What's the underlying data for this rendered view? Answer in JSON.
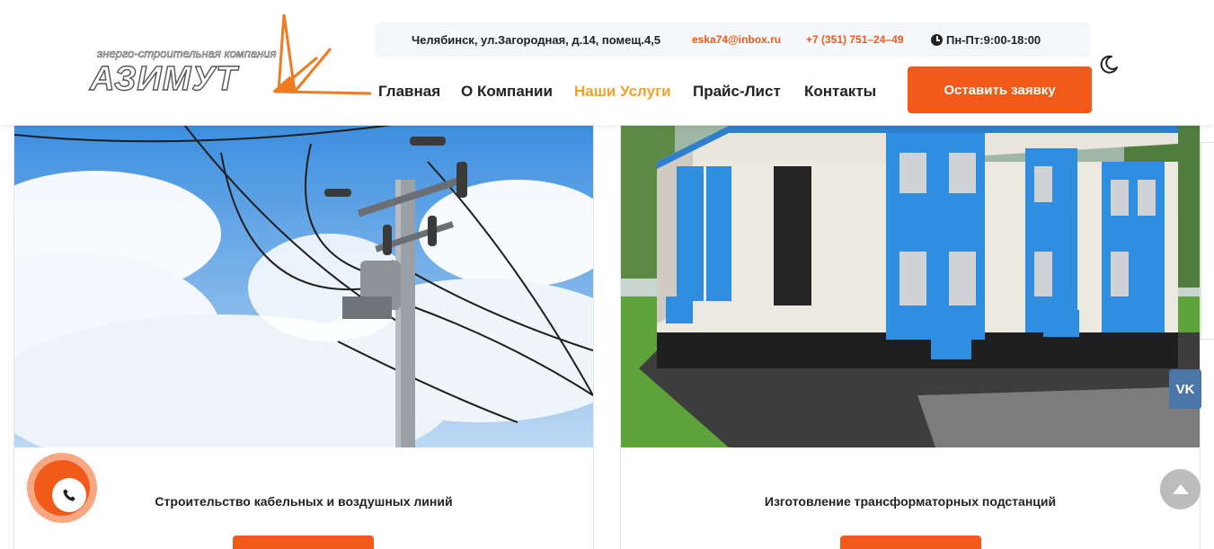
{
  "header": {
    "logo": {
      "tagline": "энерго-строительная компания",
      "name": "АЗИМУТ"
    },
    "topbar": {
      "address": "Челябинск, ул.Загородная, д.14, помещ.4,5",
      "email": "eska74@inbox.ru",
      "phone": "+7 (351) 751–24–49",
      "hours": "Пн-Пт:9:00-18:00"
    },
    "nav": [
      {
        "label": "Главная",
        "active": false
      },
      {
        "label": "О Компании",
        "active": false
      },
      {
        "label": "Наши Услуги",
        "active": true
      },
      {
        "label": "Прайс-Лист",
        "active": false
      },
      {
        "label": "Контакты",
        "active": false
      }
    ],
    "cta_label": "Оставить заявку",
    "theme_icon": "moon-icon"
  },
  "cards": [
    {
      "title": "Строительство кабельных и воздушных линий",
      "image": "power-line-pole"
    },
    {
      "title": "Изготовление трансформаторных подстанций",
      "image": "transformer-substation"
    }
  ],
  "floating": {
    "vk_label": "VK",
    "call_icon": "phone-icon",
    "scroll_icon": "arrow-up-icon"
  },
  "colors": {
    "accent": "#f25a1a",
    "nav_active": "#f0a32b",
    "vk": "#4a76a8"
  }
}
